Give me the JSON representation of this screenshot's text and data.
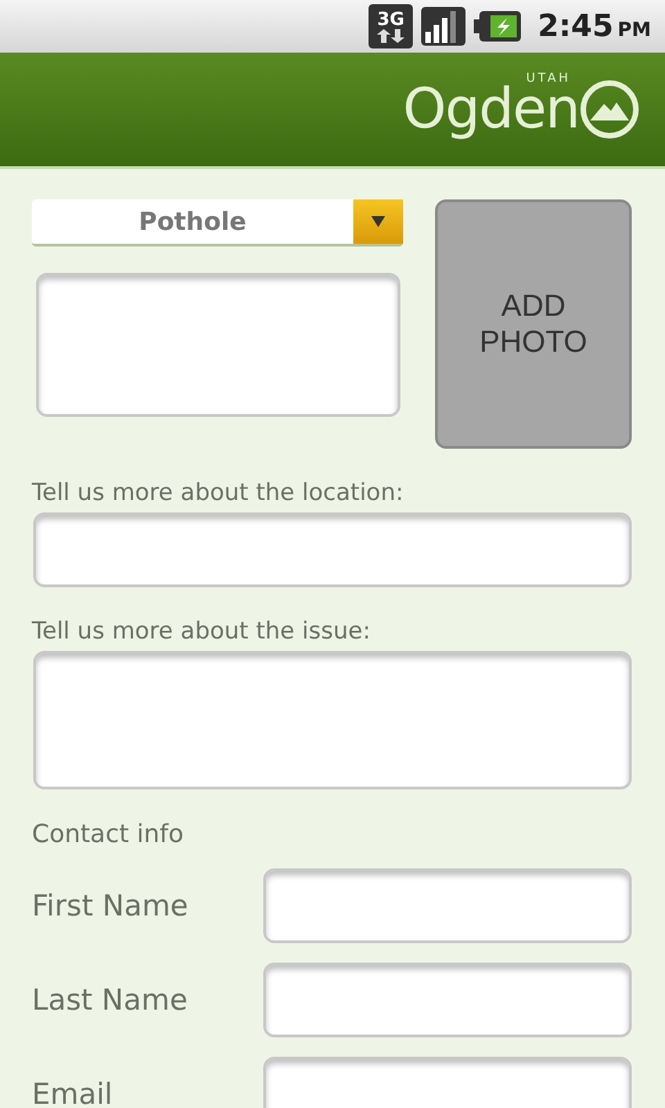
{
  "status_bar": {
    "network": "3G",
    "time": "2:45",
    "period": "PM"
  },
  "header": {
    "logo_text": "Ogden",
    "logo_subtext": "UTAH"
  },
  "issue_type": {
    "value": "Pothole"
  },
  "photo_button": {
    "label_lines": [
      "ADD",
      "PHOTO"
    ]
  },
  "location": {
    "label": "Tell us more about the location:"
  },
  "issue": {
    "label": "Tell us more about the issue:"
  },
  "contact": {
    "heading": "Contact info",
    "fields": [
      {
        "label": "First Name"
      },
      {
        "label": "Last Name"
      },
      {
        "label": "Email"
      }
    ]
  }
}
